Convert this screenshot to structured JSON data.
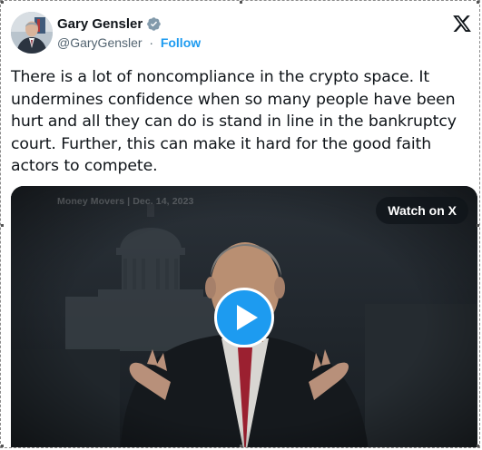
{
  "author": {
    "name": "Gary Gensler",
    "handle": "@GaryGensler",
    "separator": "·",
    "follow_label": "Follow",
    "verified_color": "#829aab",
    "avatar_icon": "profile-photo"
  },
  "platform": {
    "logo_icon": "x-logo-icon"
  },
  "tweet": {
    "text": "There is a lot of noncompliance in the crypto space. It undermines confidence when so many people have been hurt and all they can do is stand in line in the bankruptcy court. Further, this can make it hard for the good faith actors to compete."
  },
  "video": {
    "watermark": "Money Movers | Dec. 14, 2023",
    "watch_label": "Watch on X",
    "play_icon": "play-icon",
    "accent_color": "#1d9bf0"
  }
}
